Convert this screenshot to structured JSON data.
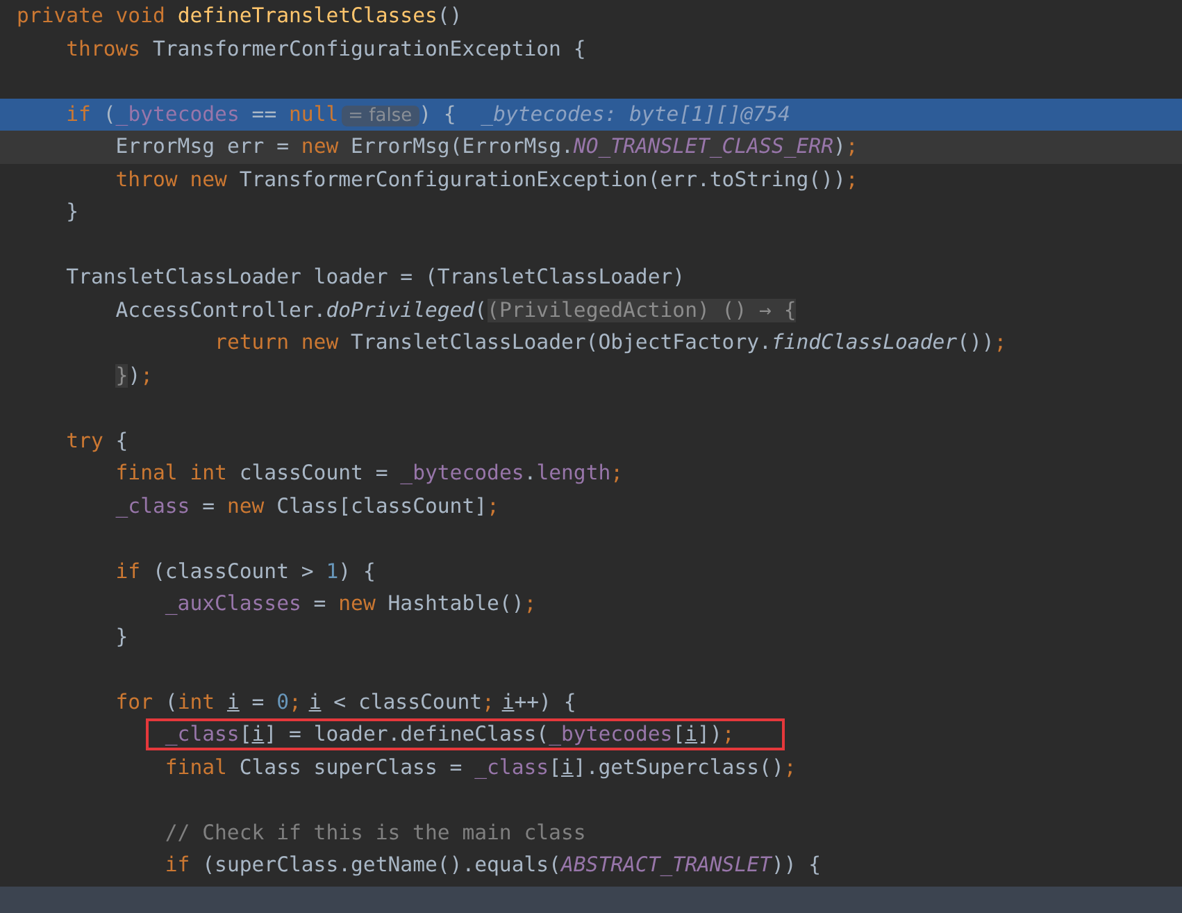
{
  "editor": {
    "lines": [
      {
        "highlighted": false,
        "current": false,
        "boxed": false,
        "tokens": [
          {
            "kind": "kw",
            "text": "private void "
          },
          {
            "kind": "method",
            "text": "defineTransletClasses"
          },
          {
            "kind": "plain",
            "text": "()"
          }
        ],
        "children": [
          {
            "highlighted": false,
            "current": false,
            "boxed": false,
            "tokens": [
              {
                "kind": "kw",
                "text": "throws "
              },
              {
                "kind": "plain",
                "text": "TransformerConfigurationException {"
              }
            ]
          },
          {
            "highlighted": false,
            "current": false,
            "boxed": false
          },
          {
            "highlighted": true,
            "current": false,
            "boxed": false,
            "tokens": [
              {
                "kind": "kw",
                "text": "if "
              },
              {
                "kind": "plain",
                "text": "("
              },
              {
                "kind": "field",
                "text": "_bytecodes"
              },
              {
                "kind": "plain",
                "text": " == "
              },
              {
                "kind": "kw",
                "text": "null"
              },
              {
                "kind": "inlay",
                "text": "= false"
              },
              {
                "kind": "plain",
                "text": ") {"
              },
              {
                "kind": "debug",
                "text": "_bytecodes: byte[1][]@754"
              }
            ],
            "children": [
              {
                "highlighted": false,
                "current": true,
                "boxed": false,
                "tokens": [
                  {
                    "kind": "plain",
                    "text": "ErrorMsg err = "
                  },
                  {
                    "kind": "kw",
                    "text": "new "
                  },
                  {
                    "kind": "plain",
                    "text": "ErrorMsg(ErrorMsg."
                  },
                  {
                    "kind": "static",
                    "text": "NO_TRANSLET_CLASS_ERR"
                  },
                  {
                    "kind": "plain",
                    "text": ")"
                  },
                  {
                    "kind": "kw",
                    "text": ";"
                  }
                ]
              },
              {
                "highlighted": false,
                "current": false,
                "boxed": false,
                "tokens": [
                  {
                    "kind": "kw",
                    "text": "throw new "
                  },
                  {
                    "kind": "plain",
                    "text": "TransformerConfigurationException(err.toString())"
                  },
                  {
                    "kind": "kw",
                    "text": ";"
                  }
                ]
              }
            ]
          },
          {
            "highlighted": false,
            "current": false,
            "boxed": false,
            "tokens": [
              {
                "kind": "plain",
                "text": "}"
              }
            ]
          },
          {
            "highlighted": false,
            "current": false,
            "boxed": false
          },
          {
            "highlighted": false,
            "current": false,
            "boxed": false,
            "tokens": [
              {
                "kind": "plain",
                "text": "TransletClassLoader loader = (TransletClassLoader)"
              }
            ],
            "children": [
              {
                "highlighted": false,
                "current": false,
                "boxed": false,
                "tokens": [
                  {
                    "kind": "plain",
                    "text": "AccessController."
                  },
                  {
                    "kind": "italic",
                    "text": "doPrivileged"
                  },
                  {
                    "kind": "plain",
                    "text": "("
                  },
                  {
                    "kind": "fold",
                    "text": "(PrivilegedAction) () → {"
                  }
                ],
                "children": [
                  {
                    "children": [
                      {
                        "highlighted": false,
                        "current": false,
                        "boxed": false,
                        "tokens": [
                          {
                            "kind": "kw",
                            "text": "return new "
                          },
                          {
                            "kind": "plain",
                            "text": "TransletClassLoader(ObjectFactory."
                          },
                          {
                            "kind": "italic",
                            "text": "findClassLoader"
                          },
                          {
                            "kind": "plain",
                            "text": "())"
                          },
                          {
                            "kind": "kw",
                            "text": ";"
                          }
                        ]
                      }
                    ]
                  }
                ]
              },
              {
                "highlighted": false,
                "current": false,
                "boxed": false,
                "tokens": [
                  {
                    "kind": "fold",
                    "text": "}"
                  },
                  {
                    "kind": "plain",
                    "text": ")"
                  },
                  {
                    "kind": "kw",
                    "text": ";"
                  }
                ]
              }
            ]
          },
          {
            "highlighted": false,
            "current": false,
            "boxed": false
          },
          {
            "highlighted": false,
            "current": false,
            "boxed": false,
            "tokens": [
              {
                "kind": "kw",
                "text": "try "
              },
              {
                "kind": "plain",
                "text": "{"
              }
            ],
            "children": [
              {
                "highlighted": false,
                "current": false,
                "boxed": false,
                "tokens": [
                  {
                    "kind": "kw",
                    "text": "final int "
                  },
                  {
                    "kind": "plain",
                    "text": "classCount = "
                  },
                  {
                    "kind": "field",
                    "text": "_bytecodes"
                  },
                  {
                    "kind": "plain",
                    "text": "."
                  },
                  {
                    "kind": "field",
                    "text": "length"
                  },
                  {
                    "kind": "kw",
                    "text": ";"
                  }
                ]
              },
              {
                "highlighted": false,
                "current": false,
                "boxed": false,
                "tokens": [
                  {
                    "kind": "field",
                    "text": "_class"
                  },
                  {
                    "kind": "plain",
                    "text": " = "
                  },
                  {
                    "kind": "kw",
                    "text": "new "
                  },
                  {
                    "kind": "plain",
                    "text": "Class[classCount]"
                  },
                  {
                    "kind": "kw",
                    "text": ";"
                  }
                ]
              },
              {
                "highlighted": false,
                "current": false,
                "boxed": false
              },
              {
                "highlighted": false,
                "current": false,
                "boxed": false,
                "tokens": [
                  {
                    "kind": "kw",
                    "text": "if "
                  },
                  {
                    "kind": "plain",
                    "text": "(classCount > "
                  },
                  {
                    "kind": "number",
                    "text": "1"
                  },
                  {
                    "kind": "plain",
                    "text": ") {"
                  }
                ],
                "children": [
                  {
                    "highlighted": false,
                    "current": false,
                    "boxed": false,
                    "tokens": [
                      {
                        "kind": "field",
                        "text": "_auxClasses"
                      },
                      {
                        "kind": "plain",
                        "text": " = "
                      },
                      {
                        "kind": "kw",
                        "text": "new "
                      },
                      {
                        "kind": "plain",
                        "text": "Hashtable()"
                      },
                      {
                        "kind": "kw",
                        "text": ";"
                      }
                    ]
                  }
                ]
              },
              {
                "highlighted": false,
                "current": false,
                "boxed": false,
                "tokens": [
                  {
                    "kind": "plain",
                    "text": "}"
                  }
                ]
              },
              {
                "highlighted": false,
                "current": false,
                "boxed": false
              },
              {
                "highlighted": false,
                "current": false,
                "boxed": false,
                "tokens": [
                  {
                    "kind": "kw",
                    "text": "for "
                  },
                  {
                    "kind": "plain",
                    "text": "("
                  },
                  {
                    "kind": "kw",
                    "text": "int "
                  },
                  {
                    "kind": "var",
                    "text": "i"
                  },
                  {
                    "kind": "plain",
                    "text": " = "
                  },
                  {
                    "kind": "number",
                    "text": "0"
                  },
                  {
                    "kind": "kw",
                    "text": ";"
                  },
                  {
                    "kind": "var",
                    "text": "i"
                  },
                  {
                    "kind": "plain",
                    "text": " < classCount"
                  },
                  {
                    "kind": "kw",
                    "text": ";"
                  },
                  {
                    "kind": "var",
                    "text": "i"
                  },
                  {
                    "kind": "plain",
                    "text": "++) {"
                  }
                ],
                "children": [
                  {
                    "highlighted": false,
                    "current": false,
                    "boxed": true,
                    "tokens": [
                      {
                        "kind": "field",
                        "text": "_class"
                      },
                      {
                        "kind": "plain",
                        "text": "["
                      },
                      {
                        "kind": "var",
                        "text": "i"
                      },
                      {
                        "kind": "plain",
                        "text": "] = loader.defineClass("
                      },
                      {
                        "kind": "field",
                        "text": "_bytecodes"
                      },
                      {
                        "kind": "plain",
                        "text": "["
                      },
                      {
                        "kind": "var",
                        "text": "i"
                      },
                      {
                        "kind": "plain",
                        "text": "])"
                      },
                      {
                        "kind": "kw",
                        "text": ";"
                      }
                    ]
                  },
                  {
                    "highlighted": false,
                    "current": false,
                    "boxed": false,
                    "tokens": [
                      {
                        "kind": "kw",
                        "text": "final "
                      },
                      {
                        "kind": "plain",
                        "text": "Class superClass = "
                      },
                      {
                        "kind": "field",
                        "text": "_class"
                      },
                      {
                        "kind": "plain",
                        "text": "["
                      },
                      {
                        "kind": "var",
                        "text": "i"
                      },
                      {
                        "kind": "plain",
                        "text": "].getSuperclass()"
                      },
                      {
                        "kind": "kw",
                        "text": ";"
                      }
                    ]
                  },
                  {
                    "highlighted": false,
                    "current": false,
                    "boxed": false
                  },
                  {
                    "highlighted": false,
                    "current": false,
                    "boxed": false,
                    "tokens": [
                      {
                        "kind": "comment",
                        "text": "// Check if this is the main class"
                      }
                    ]
                  },
                  {
                    "highlighted": false,
                    "current": false,
                    "boxed": false,
                    "tokens": [
                      {
                        "kind": "kw",
                        "text": "if "
                      },
                      {
                        "kind": "plain",
                        "text": "(superClass.getName().equals("
                      },
                      {
                        "kind": "static",
                        "text": "ABSTRACT_TRANSLET"
                      },
                      {
                        "kind": "plain",
                        "text": ")) {"
                      }
                    ]
                  }
                ]
              }
            ]
          }
        ]
      }
    ]
  }
}
